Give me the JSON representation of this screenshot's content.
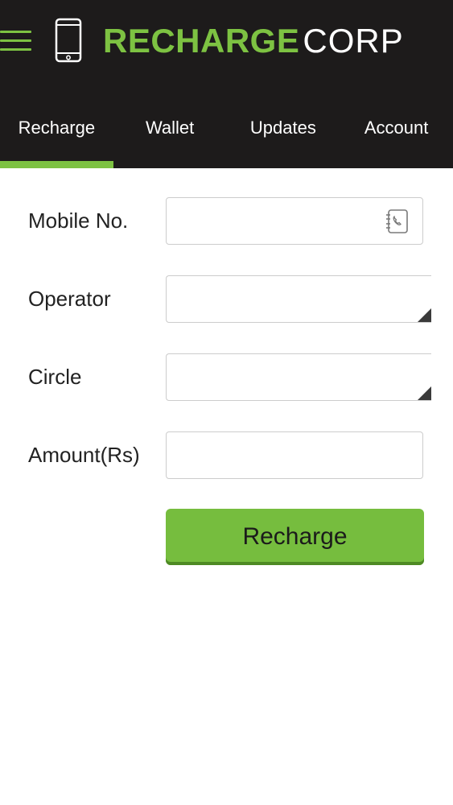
{
  "app": {
    "logo_part1": "RECHARGE",
    "logo_part2": "CORP",
    "brand_green": "#7dc242",
    "header_bg": "#1d1b1b"
  },
  "tabs": [
    {
      "label": "Recharge",
      "active": true
    },
    {
      "label": "Wallet",
      "active": false
    },
    {
      "label": "Updates",
      "active": false
    },
    {
      "label": "Account",
      "active": false
    }
  ],
  "form": {
    "mobile_label": "Mobile No.",
    "mobile_value": "",
    "operator_label": "Operator",
    "operator_value": "",
    "circle_label": "Circle",
    "circle_value": "",
    "amount_label": "Amount(Rs)",
    "amount_value": "",
    "submit_label": "Recharge"
  },
  "icons": {
    "menu": "hamburger-menu-icon",
    "phone": "mobile-phone-icon",
    "contacts": "contact-book-icon",
    "dropdown": "dropdown-triangle-icon"
  }
}
